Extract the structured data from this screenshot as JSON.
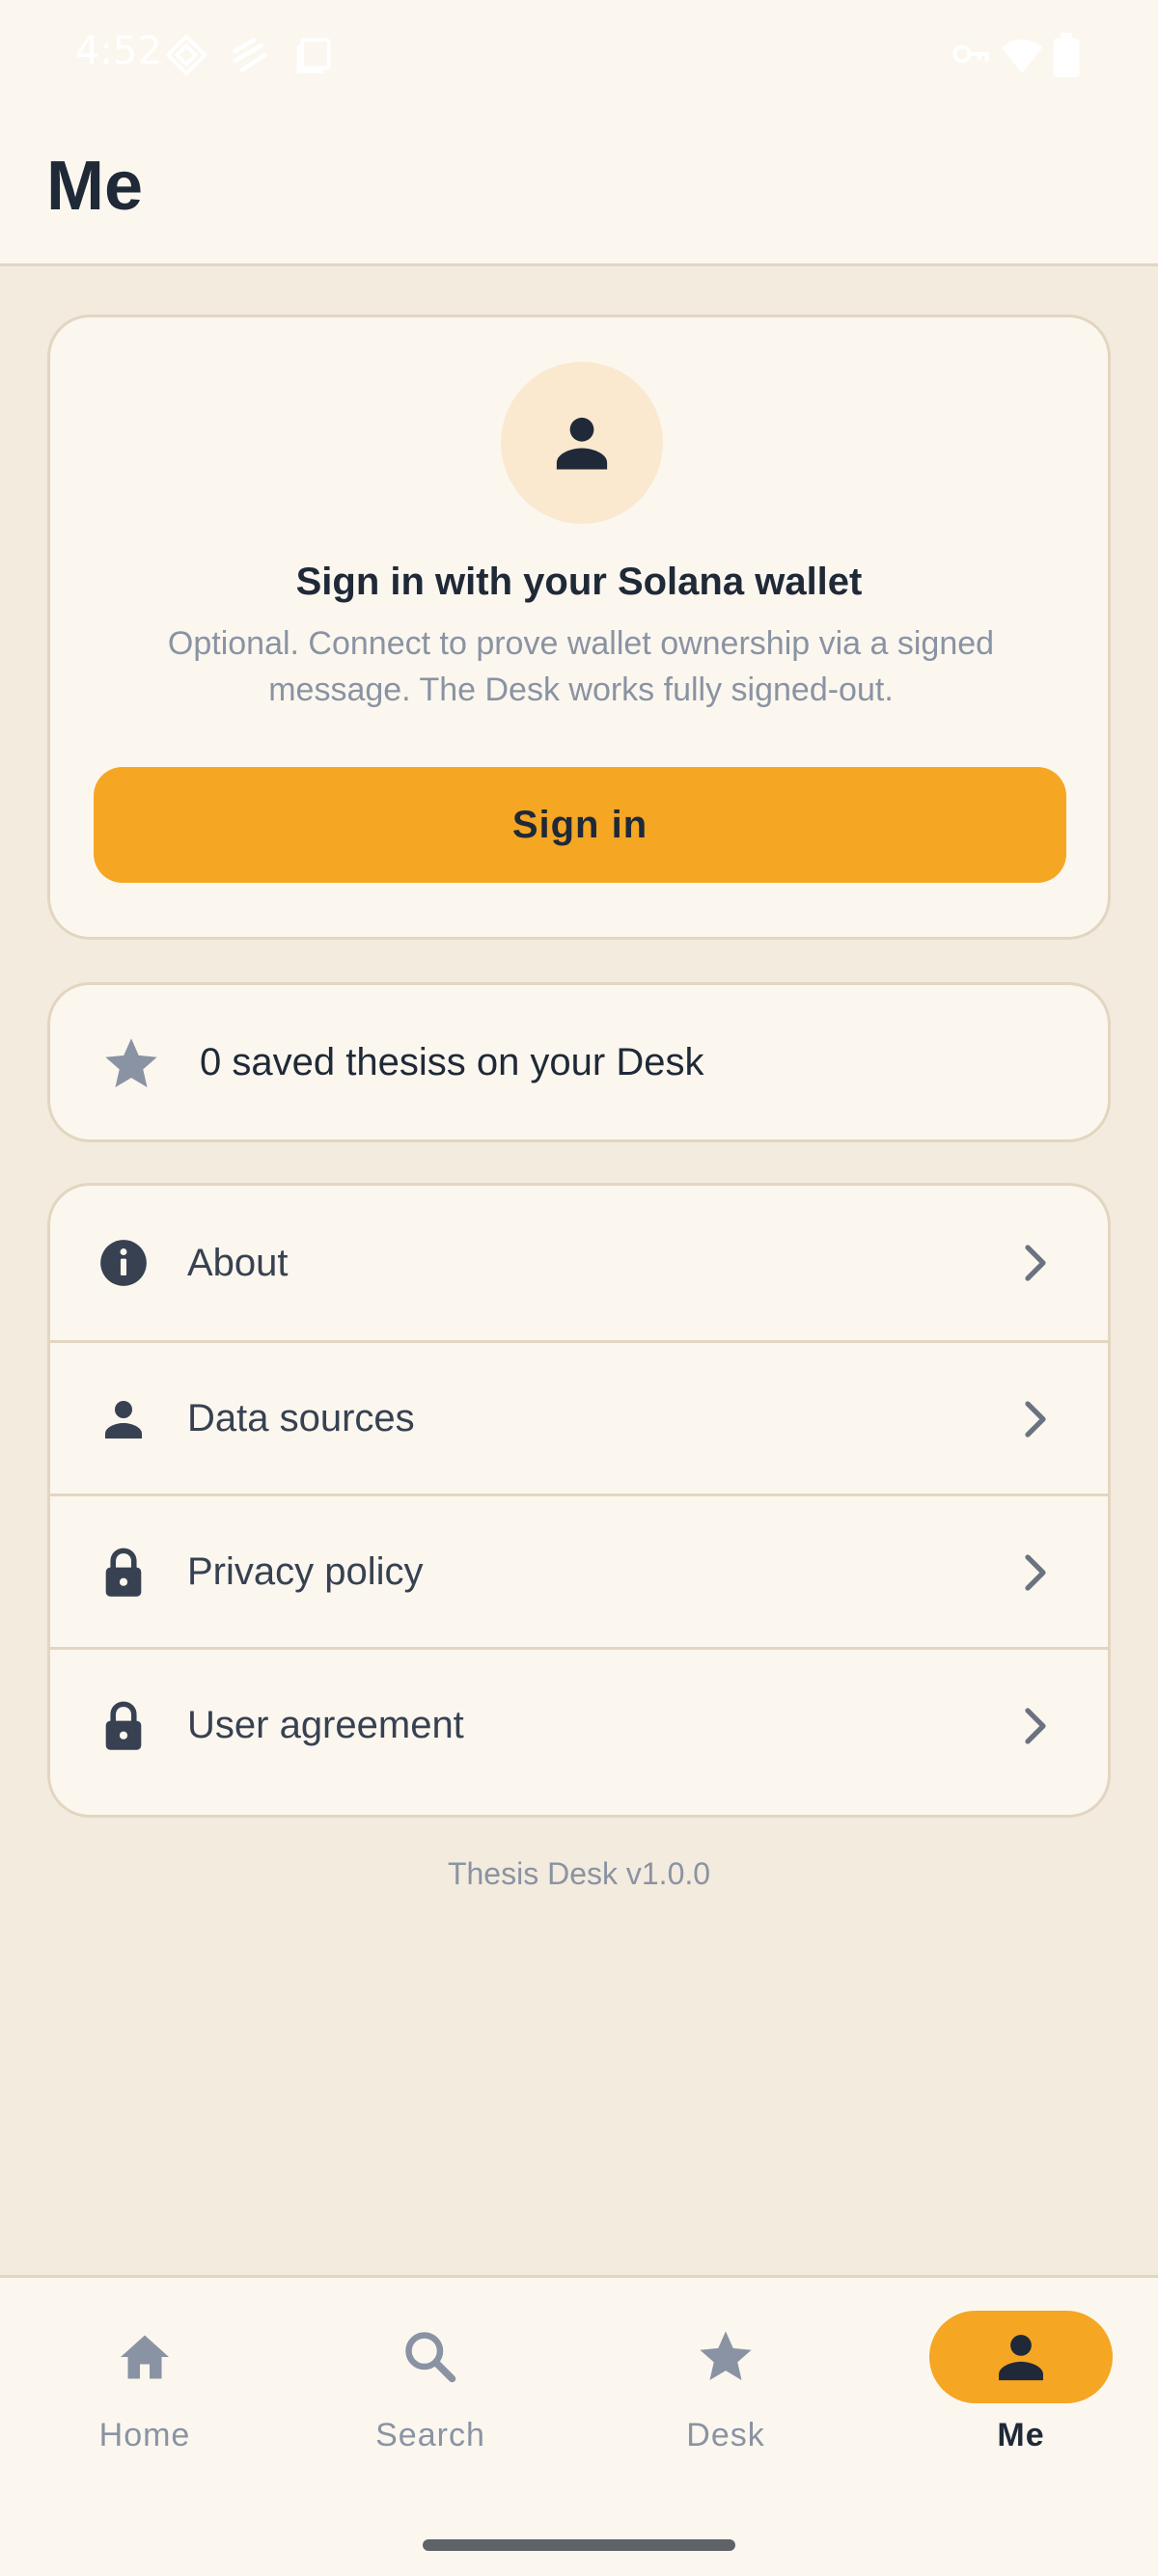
{
  "status_bar": {
    "time": "4:52"
  },
  "header": {
    "title": "Me"
  },
  "signin_card": {
    "avatar_icon": "person-icon",
    "title": "Sign in with your Solana wallet",
    "description": "Optional. Connect to prove wallet ownership via a signed message. The Desk works fully signed-out.",
    "button_label": "Sign in"
  },
  "saved": {
    "icon": "star-icon",
    "text": "0 saved thesiss on your Desk"
  },
  "menu": {
    "items": [
      {
        "label": "About",
        "icon": "info-icon"
      },
      {
        "label": "Data sources",
        "icon": "person-icon"
      },
      {
        "label": "Privacy policy",
        "icon": "lock-icon"
      },
      {
        "label": "User agreement",
        "icon": "lock-icon"
      }
    ]
  },
  "version": "Thesis Desk v1.0.0",
  "bottom_nav": {
    "items": [
      {
        "label": "Home",
        "icon": "home-icon"
      },
      {
        "label": "Search",
        "icon": "search-icon"
      },
      {
        "label": "Desk",
        "icon": "star-icon"
      },
      {
        "label": "Me",
        "icon": "person-icon",
        "active": true
      }
    ]
  },
  "colors": {
    "accent": "#f5a623",
    "background": "#f3ebdd",
    "surface": "#fbf7ef",
    "border": "#e2d6c1",
    "text": "#1f2937",
    "muted": "#8a93a3"
  }
}
